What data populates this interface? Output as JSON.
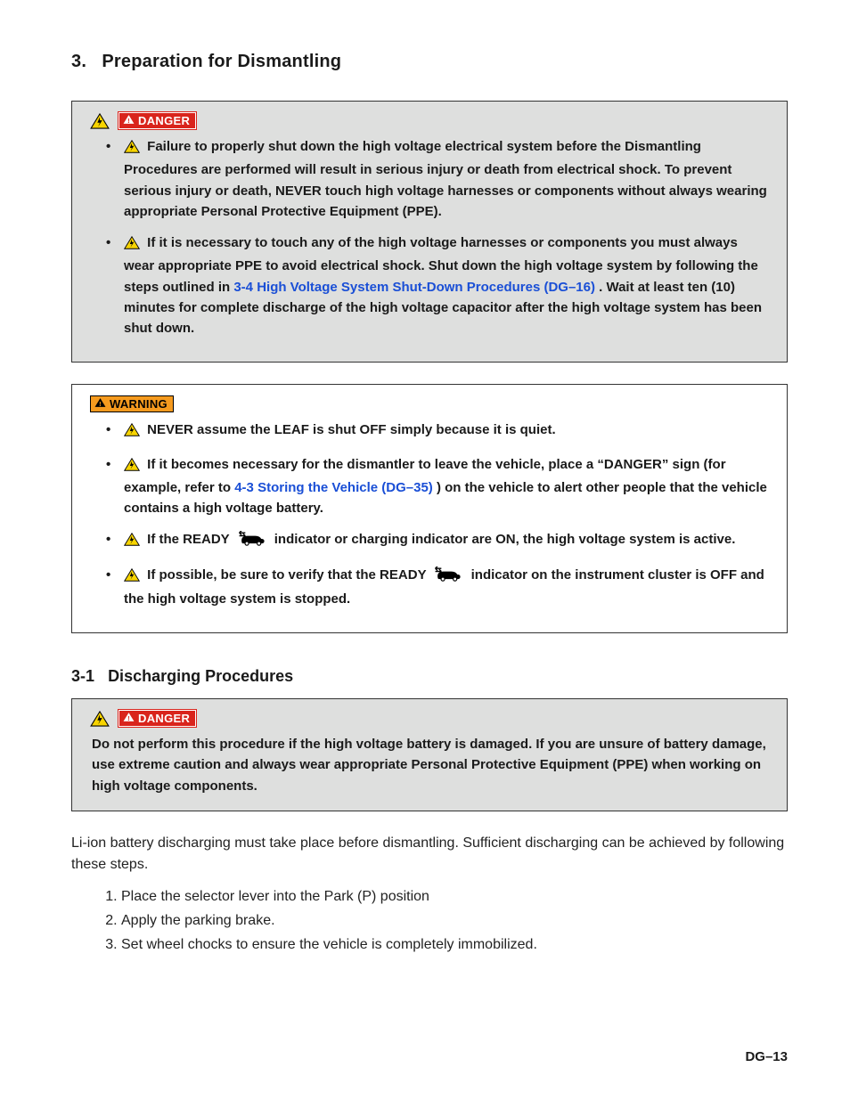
{
  "section": {
    "number": "3.",
    "title": "Preparation for Dismantling"
  },
  "danger1": {
    "label": "DANGER",
    "items": [
      {
        "pre": "Failure to properly shut down the high voltage electrical system before the Dismantling Procedures are performed will result in serious injury or death from electrical shock. To prevent serious injury or death, NEVER touch high voltage harnesses or components without always wearing appropriate Personal Protective Equipment (PPE)."
      },
      {
        "pre": "If it is necessary to touch any of the high voltage harnesses or components you must always wear appropriate PPE to avoid electrical shock. Shut down the high voltage system by following the steps outlined in ",
        "link": "3-4  High Voltage System Shut-Down Procedures (DG–16)",
        "post": ". Wait at least ten (10) minutes for complete discharge of the high voltage capacitor after the high voltage system has been shut down."
      }
    ]
  },
  "warning": {
    "label": "WARNING",
    "items": [
      {
        "pre": "NEVER assume the LEAF is shut OFF simply because it is quiet."
      },
      {
        "pre": "If it becomes necessary for the dismantler to leave the vehicle, place a “DANGER” sign (for example, refer to ",
        "link": "4-3  Storing the Vehicle (DG–35)",
        "post": ") on the vehicle to alert other people that the vehicle contains a high voltage battery."
      },
      {
        "pre": "If the READY ",
        "readyIcon": true,
        "post": " indicator or charging indicator are ON, the high voltage system is active."
      },
      {
        "pre": "If possible, be sure to verify that the READY ",
        "readyIcon": true,
        "post": " indicator on the instrument cluster is OFF and the high voltage system is stopped."
      }
    ]
  },
  "subsection": {
    "number": "3-1",
    "title": "Discharging Procedures"
  },
  "danger2": {
    "label": "DANGER",
    "body": "Do not perform this procedure if the high voltage battery is damaged. If you are unsure of battery damage, use extreme caution and always wear appropriate Personal Protective Equipment (PPE) when working on high voltage components."
  },
  "intro_text": "Li-ion battery discharging must take place before dismantling. Sufficient discharging can be achieved by following these steps.",
  "steps": [
    "Place the selector lever into the Park (P) position",
    "Apply the parking brake.",
    "Set wheel chocks to ensure the vehicle is completely immobilized."
  ],
  "page_number": "DG–13",
  "icons": {
    "hv": "high-voltage-triangle",
    "warn_tri": "warning-triangle",
    "ready": "ready-car-arrows"
  }
}
